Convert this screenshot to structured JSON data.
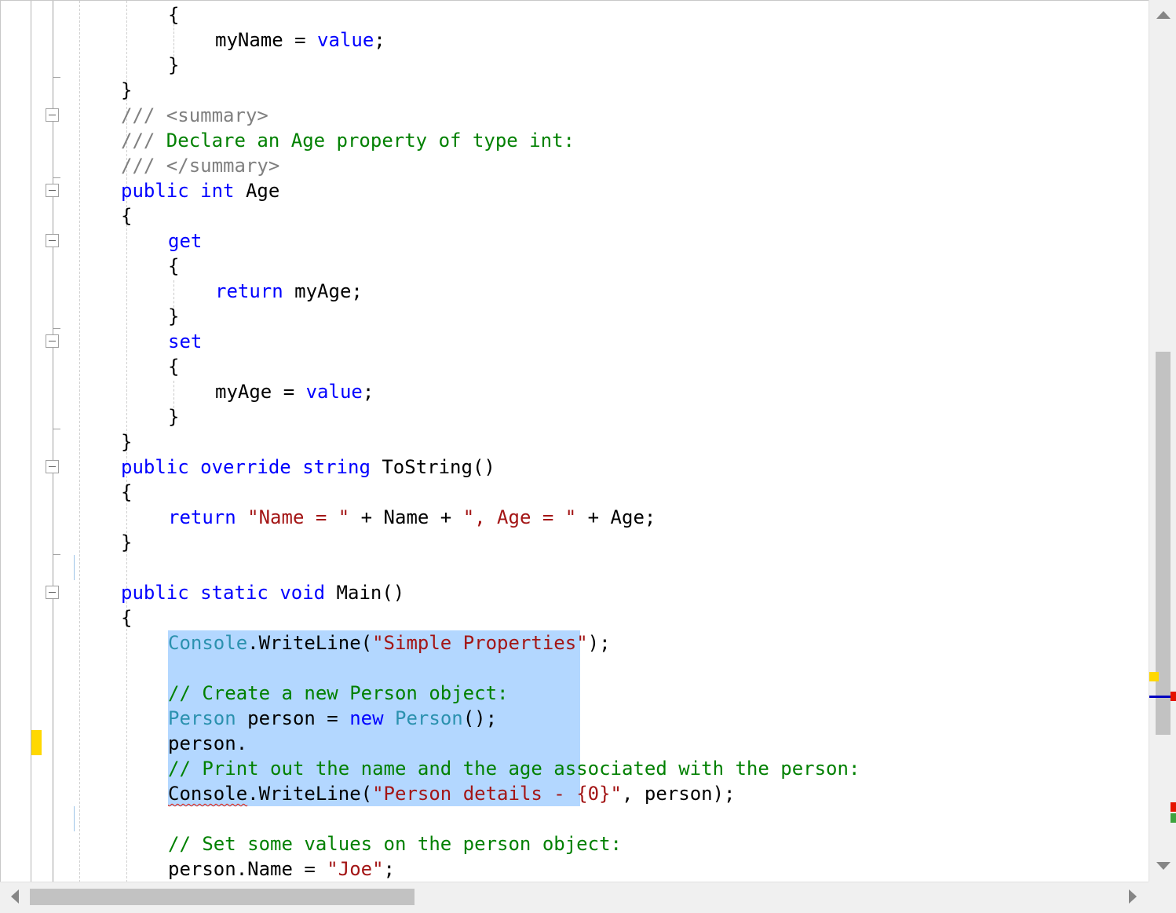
{
  "code": {
    "lines": [
      {
        "indent": 4,
        "tokens": [
          {
            "t": "{",
            "c": "plain"
          }
        ]
      },
      {
        "indent": 8,
        "tokens": [
          {
            "t": "myName = ",
            "c": "plain"
          },
          {
            "t": "value",
            "c": "kw"
          },
          {
            "t": ";",
            "c": "plain"
          }
        ]
      },
      {
        "indent": 4,
        "tokens": [
          {
            "t": "}",
            "c": "plain"
          }
        ]
      },
      {
        "indent": 0,
        "tokens": [
          {
            "t": "}",
            "c": "plain"
          }
        ]
      },
      {
        "indent": 0,
        "tokens": [
          {
            "t": "/// <summary>",
            "c": "doc"
          }
        ]
      },
      {
        "indent": 0,
        "tokens": [
          {
            "t": "/// ",
            "c": "doc"
          },
          {
            "t": "Declare an Age property of type int:",
            "c": "com"
          }
        ]
      },
      {
        "indent": 0,
        "tokens": [
          {
            "t": "/// </summary>",
            "c": "doc"
          }
        ]
      },
      {
        "indent": 0,
        "tokens": [
          {
            "t": "public",
            "c": "kw"
          },
          {
            "t": " ",
            "c": "plain"
          },
          {
            "t": "int",
            "c": "kw"
          },
          {
            "t": " Age",
            "c": "plain"
          }
        ]
      },
      {
        "indent": 0,
        "tokens": [
          {
            "t": "{",
            "c": "plain"
          }
        ]
      },
      {
        "indent": 4,
        "tokens": [
          {
            "t": "get",
            "c": "kw"
          }
        ]
      },
      {
        "indent": 4,
        "tokens": [
          {
            "t": "{",
            "c": "plain"
          }
        ]
      },
      {
        "indent": 8,
        "tokens": [
          {
            "t": "return",
            "c": "kw"
          },
          {
            "t": " myAge;",
            "c": "plain"
          }
        ]
      },
      {
        "indent": 4,
        "tokens": [
          {
            "t": "}",
            "c": "plain"
          }
        ]
      },
      {
        "indent": 4,
        "tokens": [
          {
            "t": "set",
            "c": "kw"
          }
        ]
      },
      {
        "indent": 4,
        "tokens": [
          {
            "t": "{",
            "c": "plain"
          }
        ]
      },
      {
        "indent": 8,
        "tokens": [
          {
            "t": "myAge = ",
            "c": "plain"
          },
          {
            "t": "value",
            "c": "kw"
          },
          {
            "t": ";",
            "c": "plain"
          }
        ]
      },
      {
        "indent": 4,
        "tokens": [
          {
            "t": "}",
            "c": "plain"
          }
        ]
      },
      {
        "indent": 0,
        "tokens": [
          {
            "t": "}",
            "c": "plain"
          }
        ]
      },
      {
        "indent": 0,
        "tokens": [
          {
            "t": "public",
            "c": "kw"
          },
          {
            "t": " ",
            "c": "plain"
          },
          {
            "t": "override",
            "c": "kw"
          },
          {
            "t": " ",
            "c": "plain"
          },
          {
            "t": "string",
            "c": "kw"
          },
          {
            "t": " ToString()",
            "c": "plain"
          }
        ]
      },
      {
        "indent": 0,
        "tokens": [
          {
            "t": "{",
            "c": "plain"
          }
        ]
      },
      {
        "indent": 4,
        "tokens": [
          {
            "t": "return",
            "c": "kw"
          },
          {
            "t": " ",
            "c": "plain"
          },
          {
            "t": "\"Name = \"",
            "c": "str"
          },
          {
            "t": " + Name + ",
            "c": "plain"
          },
          {
            "t": "\", Age = \"",
            "c": "str"
          },
          {
            "t": " + Age;",
            "c": "plain"
          }
        ]
      },
      {
        "indent": 0,
        "tokens": [
          {
            "t": "}",
            "c": "plain"
          }
        ]
      },
      {
        "indent": 0,
        "tokens": []
      },
      {
        "indent": 0,
        "tokens": [
          {
            "t": "public",
            "c": "kw"
          },
          {
            "t": " ",
            "c": "plain"
          },
          {
            "t": "static",
            "c": "kw"
          },
          {
            "t": " ",
            "c": "plain"
          },
          {
            "t": "void",
            "c": "kw"
          },
          {
            "t": " Main()",
            "c": "plain"
          }
        ]
      },
      {
        "indent": 0,
        "tokens": [
          {
            "t": "{",
            "c": "plain"
          }
        ]
      },
      {
        "indent": 4,
        "tokens": [
          {
            "t": "Console",
            "c": "ty"
          },
          {
            "t": ".WriteLine(",
            "c": "plain"
          },
          {
            "t": "\"Simple Properties\"",
            "c": "str"
          },
          {
            "t": ");",
            "c": "plain"
          }
        ]
      },
      {
        "indent": 0,
        "tokens": []
      },
      {
        "indent": 4,
        "tokens": [
          {
            "t": "// Create a new Person object:",
            "c": "com"
          }
        ]
      },
      {
        "indent": 4,
        "tokens": [
          {
            "t": "Person",
            "c": "ty"
          },
          {
            "t": " person = ",
            "c": "plain"
          },
          {
            "t": "new",
            "c": "kw"
          },
          {
            "t": " ",
            "c": "plain"
          },
          {
            "t": "Person",
            "c": "ty"
          },
          {
            "t": "();",
            "c": "plain"
          }
        ]
      },
      {
        "indent": 4,
        "tokens": [
          {
            "t": "person.",
            "c": "plain"
          }
        ]
      },
      {
        "indent": 4,
        "tokens": [
          {
            "t": "// Print out the name and the age associated with the person:",
            "c": "com"
          }
        ]
      },
      {
        "indent": 4,
        "tokens": [
          {
            "t": "Console",
            "c": "plain squiggle"
          },
          {
            "t": ".WriteLine(",
            "c": "plain"
          },
          {
            "t": "\"Person details - {0}\"",
            "c": "str"
          },
          {
            "t": ", person);",
            "c": "plain"
          }
        ]
      },
      {
        "indent": 0,
        "tokens": []
      },
      {
        "indent": 4,
        "tokens": [
          {
            "t": "// Set some values on the person object:",
            "c": "com"
          }
        ]
      },
      {
        "indent": 4,
        "tokens": [
          {
            "t": "person.Name = ",
            "c": "plain"
          },
          {
            "t": "\"Joe\"",
            "c": "str"
          },
          {
            "t": ";",
            "c": "plain"
          }
        ]
      }
    ]
  },
  "colors": {
    "keyword": "#0000ff",
    "type": "#2b91af",
    "string": "#a31515",
    "comment": "#008000",
    "doc_comment": "#808080",
    "selection": "#b3d7ff",
    "change_marker": "#ffd800",
    "error_marker": "#e51400",
    "ok_marker": "#3fa33f",
    "caret_marker": "#0000c0"
  },
  "icons": {
    "fold": "collapse-minus-icon",
    "scroll_up": "triangle-up-icon",
    "scroll_down": "triangle-down-icon",
    "scroll_left": "triangle-left-icon",
    "scroll_right": "triangle-right-icon"
  }
}
